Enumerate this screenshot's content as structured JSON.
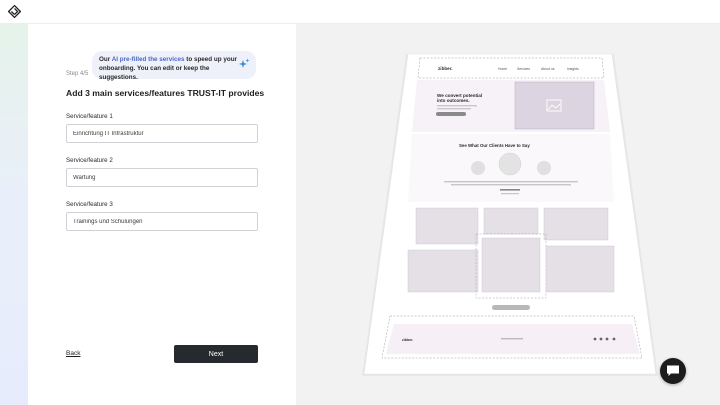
{
  "app": {
    "logo_icon": "diamond-logo-icon"
  },
  "hint": {
    "prefix": "Our ",
    "highlight": "AI pre-filled the services",
    "suffix": " to speed up your onboarding. You can edit or keep the suggestions.",
    "icon": "sparkle-icon",
    "accent_color": "#4a67c9"
  },
  "step": {
    "label": "Step 4/5"
  },
  "form": {
    "title": "Add 3 main services/features TRUST-IT provides",
    "fields": [
      {
        "label": "Service/feature 1",
        "value": "Einrichtung IT Infrastruktur"
      },
      {
        "label": "Service/feature 2",
        "value": "Wartung"
      },
      {
        "label": "Service/feature 3",
        "value": "Trainings und Schulungen"
      }
    ]
  },
  "nav": {
    "back_label": "Back",
    "next_label": "Next"
  },
  "preview": {
    "logo": "zibber.",
    "menu": [
      "Home",
      "Services",
      "About us",
      "Insights"
    ],
    "hero_title_line1": "We convert potential",
    "hero_title_line2": "into outcomes.",
    "testimonials_title": "See What Our Clients Have to Say",
    "footer_logo": "zibber."
  },
  "chat": {
    "icon": "chat-bubble-icon"
  }
}
